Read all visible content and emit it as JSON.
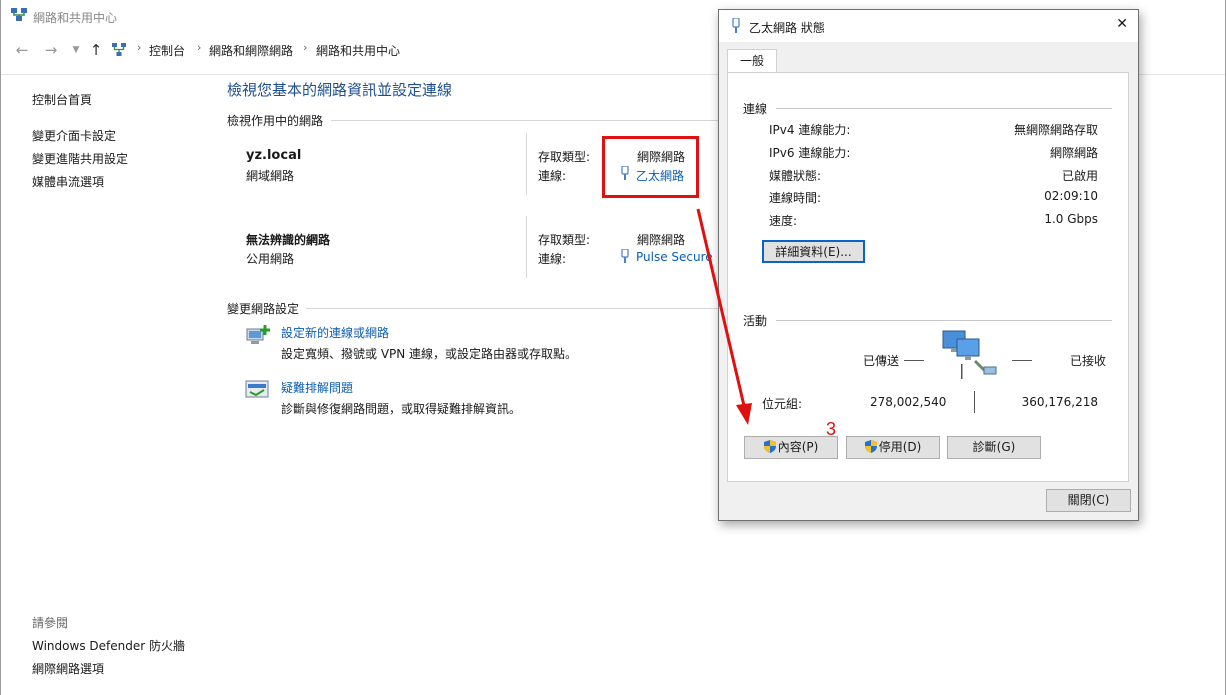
{
  "window": {
    "title": "網路和共用中心",
    "breadcrumb": [
      "控制台",
      "網路和網際網路",
      "網路和共用中心"
    ]
  },
  "sidebar": {
    "home": "控制台首頁",
    "items": [
      "變更介面卡設定",
      "變更進階共用設定",
      "媒體串流選項"
    ],
    "see_also_title": "請參閱",
    "see_also": [
      "Windows Defender 防火牆",
      "網際網路選項"
    ]
  },
  "main": {
    "heading": "檢視您基本的網路資訊並設定連線",
    "active_networks_label": "檢視作用中的網路",
    "networks": [
      {
        "name": "yz.local",
        "type": "網域網路",
        "access_label": "存取類型:",
        "access_value": "網際網路",
        "conn_label": "連線:",
        "conn_value": "乙太網路"
      },
      {
        "name": "無法辨識的網路",
        "type": "公用網路",
        "access_label": "存取類型:",
        "access_value": "網際網路",
        "conn_label": "連線:",
        "conn_value": "Pulse Secure"
      }
    ],
    "change_settings_label": "變更網路設定",
    "tasks": [
      {
        "title": "設定新的連線或網路",
        "desc": "設定寬頻、撥號或 VPN 連線，或設定路由器或存取點。"
      },
      {
        "title": "疑難排解問題",
        "desc": "診斷與修復網路問題，或取得疑難排解資訊。"
      }
    ]
  },
  "dialog": {
    "title": "乙太網路 狀態",
    "close_glyph": "✕",
    "tab": "一般",
    "connection_group": "連線",
    "rows": [
      {
        "label": "IPv4 連線能力:",
        "value": "無網際網路存取"
      },
      {
        "label": "IPv6 連線能力:",
        "value": "網際網路"
      },
      {
        "label": "媒體狀態:",
        "value": "已啟用"
      },
      {
        "label": "連線時間:",
        "value": "02:09:10"
      },
      {
        "label": "速度:",
        "value": "1.0 Gbps"
      }
    ],
    "details_button": "詳細資料(E)...",
    "activity_group": "活動",
    "sent_label": "已傳送",
    "received_label": "已接收",
    "bytes_label": "位元組:",
    "bytes_sent": "278,002,540",
    "bytes_received": "360,176,218",
    "properties_button": "內容(P)",
    "disable_button": "停用(D)",
    "diagnose_button": "診斷(G)",
    "close_button": "關閉(C)"
  },
  "annotation": {
    "step": "3",
    "color": "#e01010"
  },
  "icons": [
    "network-center-icon",
    "back-icon",
    "forward-icon",
    "up-icon",
    "ethernet-icon",
    "uac-shield-icon",
    "network-computers-icon"
  ]
}
